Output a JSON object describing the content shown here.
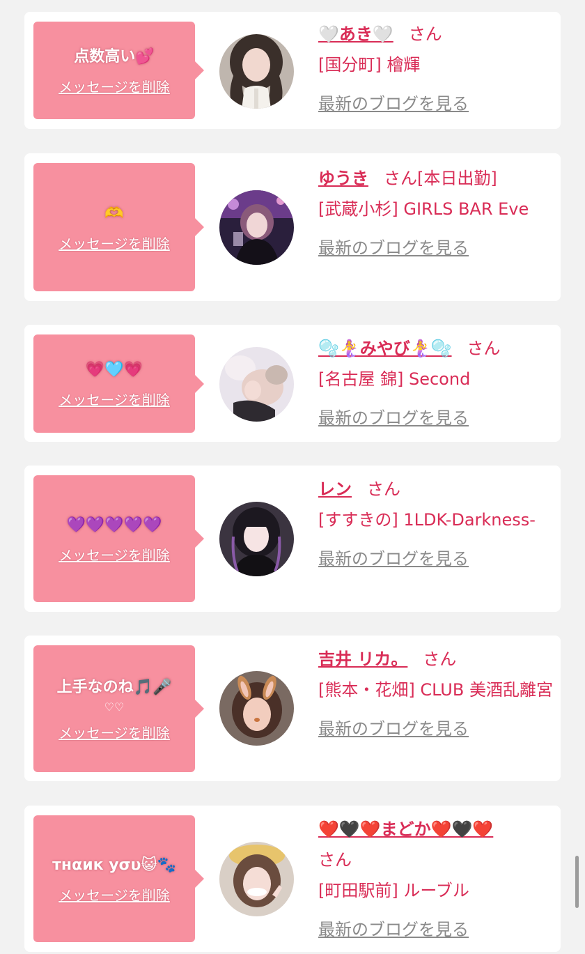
{
  "common": {
    "delete_label": "メッセージを削除",
    "blog_label": "最新のブログを見る",
    "san": "さん"
  },
  "colors": {
    "page_background": "#f2f2f2",
    "bubble": "#f7909f",
    "accent_pink": "#d92c56",
    "link_gray": "#8a8a8a"
  },
  "cards": [
    {
      "message": "点数高い💕",
      "message_sub": "",
      "name": "🤍あき🤍",
      "status": "",
      "shop": "[国分町] 檜輝"
    },
    {
      "message": "🫶",
      "message_sub": "",
      "name": "ゆうき",
      "status": "[本日出勤]",
      "shop": "[武蔵小杉] GIRLS BAR Eve"
    },
    {
      "message": "💗🩵💗",
      "message_sub": "",
      "name": "🫧🧜‍♀️みやび🧜‍♀️🫧",
      "status": "",
      "shop": "[名古屋 錦] Second"
    },
    {
      "message": "💜💜💜💜💜",
      "message_sub": "",
      "name": "レン",
      "status": "",
      "shop": "[すすきの] 1LDK-Darkness-"
    },
    {
      "message": "上手なのね🎵🎤",
      "message_sub": "♡♡",
      "name": "吉井 リカ。",
      "status": "",
      "shop": "[熊本・花畑] CLUB 美酒乱離宮"
    },
    {
      "message": "тнαик уσυ😺🐾",
      "message_sub": "",
      "name": "❤️🖤❤️まどか❤️🖤❤️",
      "status": "",
      "shop": "[町田駅前] ルーブル"
    }
  ]
}
